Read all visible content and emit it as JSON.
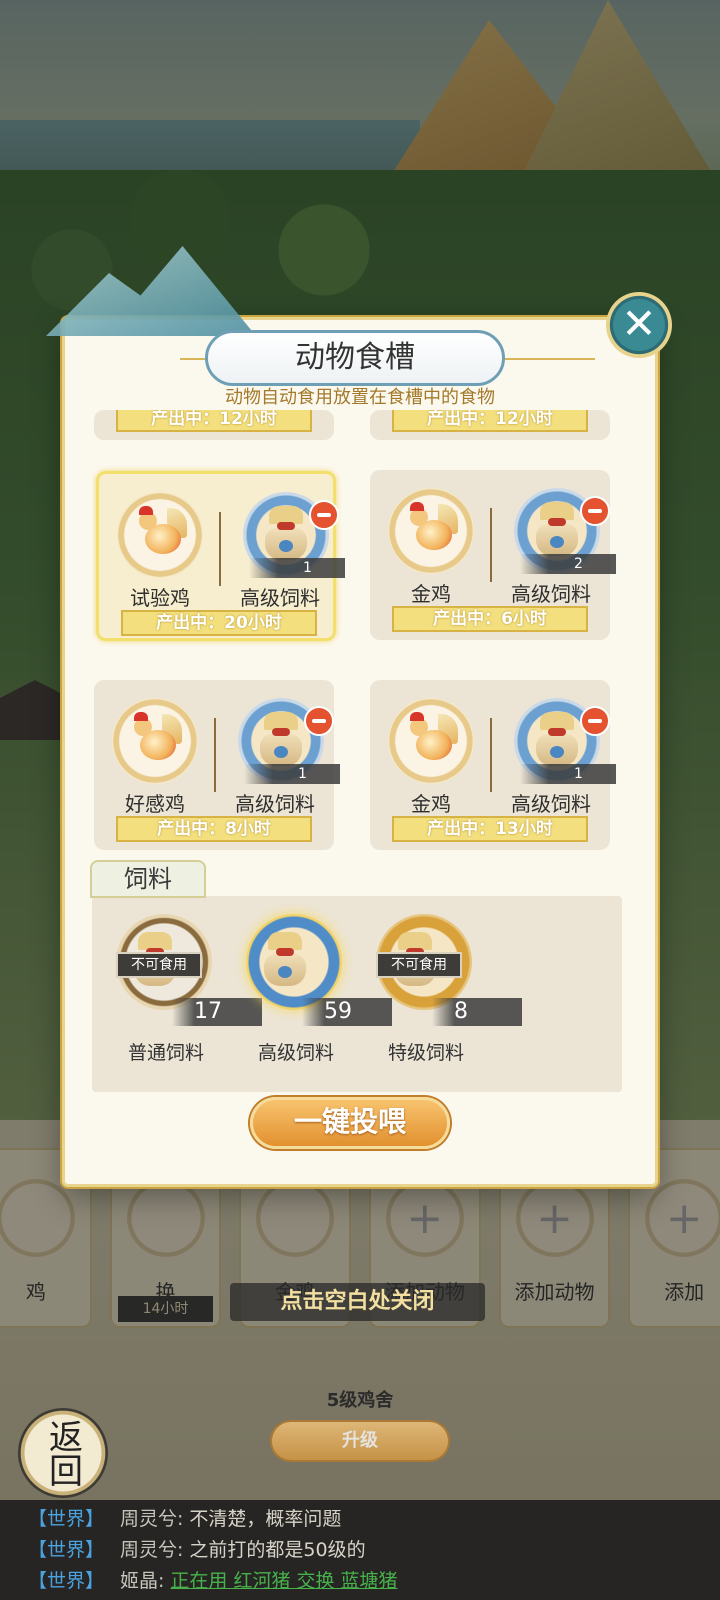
{
  "modal": {
    "title": "动物食槽",
    "subtitle": "动物自动食用放置在食槽中的食物",
    "close_icon": "close-icon",
    "partial_row": [
      {
        "production": "产出中：12小时"
      },
      {
        "production": "产出中：12小时"
      }
    ],
    "cards": [
      {
        "animal": "试验鸡",
        "feed": "高级饲料",
        "qty": "1",
        "production": "产出中：20小时",
        "selected": true
      },
      {
        "animal": "金鸡",
        "feed": "高级饲料",
        "qty": "2",
        "production": "产出中：6小时",
        "selected": false
      },
      {
        "animal": "好感鸡",
        "feed": "高级饲料",
        "qty": "1",
        "production": "产出中：8小时",
        "selected": false
      },
      {
        "animal": "金鸡",
        "feed": "高级饲料",
        "qty": "1",
        "production": "产出中：13小时",
        "selected": false
      }
    ],
    "feed_section": {
      "tab_label": "饲料",
      "items": [
        {
          "name": "普通饲料",
          "count": "17",
          "banner": "不可食用"
        },
        {
          "name": "高级饲料",
          "count": "59",
          "banner": ""
        },
        {
          "name": "特级饲料",
          "count": "8",
          "banner": "不可食用"
        }
      ]
    },
    "feed_all_button": "一键投喂"
  },
  "close_hint": "点击空白处关闭",
  "background": {
    "slots": [
      {
        "name": "鸡",
        "time": ""
      },
      {
        "name": "换",
        "time": "14小时"
      },
      {
        "name": "金鸡",
        "time": ""
      },
      {
        "name": "添加动物",
        "time": ""
      },
      {
        "name": "添加动物",
        "time": ""
      },
      {
        "name": "添加",
        "time": ""
      }
    ],
    "coop_title": "5级鸡舍",
    "upgrade_button": "升级",
    "back_button": "返回"
  },
  "chat": [
    {
      "channel": "【世界】",
      "sender": "周灵兮:",
      "message": "不清楚，概率问题",
      "links": []
    },
    {
      "channel": "【世界】",
      "sender": "周灵兮:",
      "message": "之前打的都是50级的",
      "links": []
    },
    {
      "channel": "【世界】",
      "sender": "姬晶:",
      "message": "",
      "links": [
        "正在用 红河猪 交换 蓝塘猪"
      ]
    }
  ]
}
